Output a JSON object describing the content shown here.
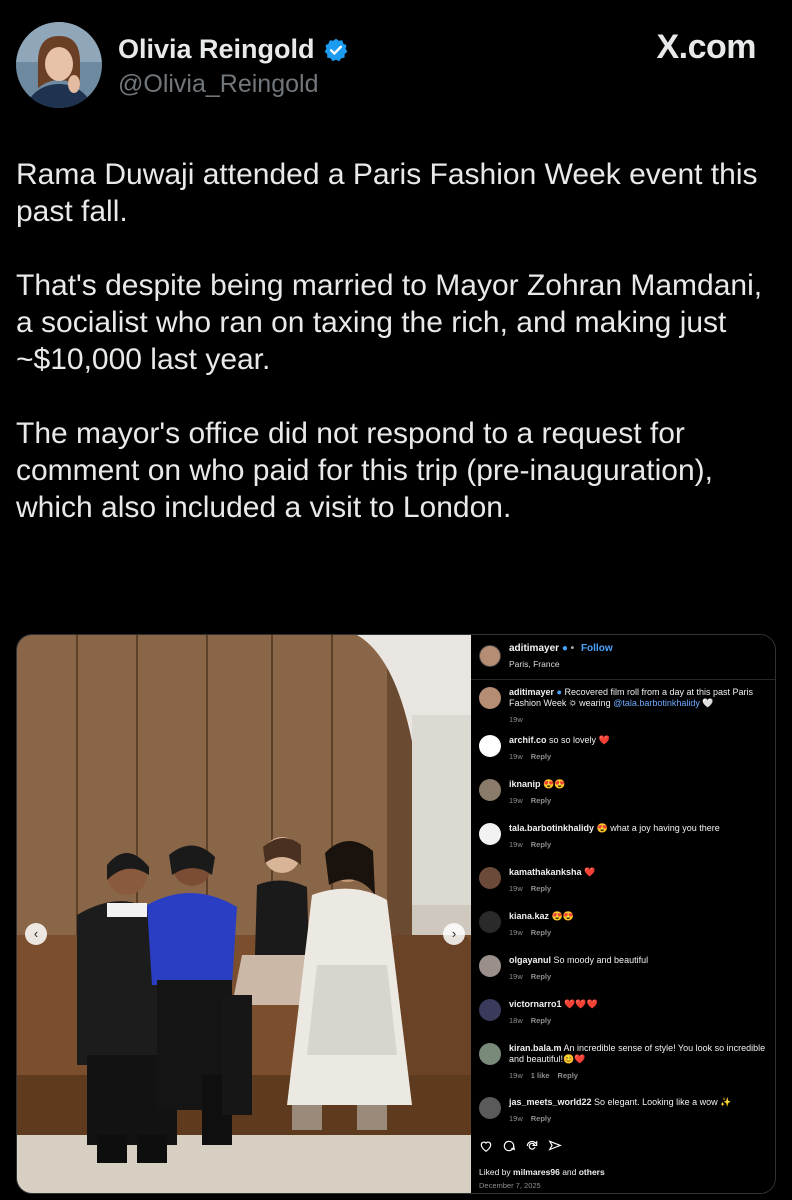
{
  "header": {
    "name": "Olivia Reingold",
    "handle": "@Olivia_Reingold",
    "brand": "X.com"
  },
  "tweet": {
    "paragraphs": [
      "Rama Duwaji attended a Paris Fashion Week event this past fall.",
      "That's despite being married to Mayor Zohran Mamdani, a socialist who ran on taxing the rich, and making just ~$10,000 last year.",
      "The mayor's office did not respond to a request for comment on who paid for this trip (pre-inauguration), which also included a visit to London."
    ]
  },
  "instagram": {
    "post_user": "aditimayer",
    "follow_label": "Follow",
    "location": "Paris, France",
    "caption": {
      "user": "aditimayer",
      "text_before": " Recovered film roll from a day at this past Paris Fashion Week 🌣 wearing ",
      "mention": "@tala.barbotinkhalidy",
      "text_after": " 🤍",
      "age": "19w"
    },
    "comments": [
      {
        "user": "archif.co",
        "text": " so so lovely ❤️",
        "age": "19w",
        "likes": "",
        "reply": "Reply",
        "avatar_color": "#ffffff"
      },
      {
        "user": "iknanip",
        "text": " 😍😍",
        "age": "19w",
        "likes": "",
        "reply": "Reply",
        "avatar_color": "#8a7b6a"
      },
      {
        "user": "tala.barbotinkhalidy",
        "text": " 😍 what a joy having you there",
        "age": "19w",
        "likes": "",
        "reply": "Reply",
        "avatar_color": "#f2f2f2"
      },
      {
        "user": "kamathakanksha",
        "text": " ❤️",
        "age": "19w",
        "likes": "",
        "reply": "Reply",
        "avatar_color": "#6b4a3a"
      },
      {
        "user": "kiana.kaz",
        "text": " 😍😍",
        "age": "19w",
        "likes": "",
        "reply": "Reply",
        "avatar_color": "#2a2a2a"
      },
      {
        "user": "olgayanul",
        "text": " So moody and beautiful",
        "age": "19w",
        "likes": "",
        "reply": "Reply",
        "avatar_color": "#9a8f8a"
      },
      {
        "user": "victornarro1",
        "text": " ❤️❤️❤️",
        "age": "18w",
        "likes": "",
        "reply": "Reply",
        "avatar_color": "#3a3a5a"
      },
      {
        "user": "kiran.bala.m",
        "text": " An incredible sense of style! You look so incredible and beautiful!😊❤️",
        "age": "19w",
        "likes": "1 like",
        "reply": "Reply",
        "avatar_color": "#7a8a7a"
      },
      {
        "user": "jas_meets_world22",
        "text": " So elegant. Looking like a wow ✨",
        "age": "19w",
        "likes": "",
        "reply": "Reply",
        "avatar_color": "#5a5a5a"
      }
    ],
    "liked_by_prefix": "Liked by ",
    "liked_by_user": "milmares96",
    "liked_by_suffix": " and ",
    "liked_by_others": "others",
    "date": "December 7, 2025"
  },
  "colors": {
    "verified": "#1d9bf0",
    "link": "#4aa3ff"
  }
}
